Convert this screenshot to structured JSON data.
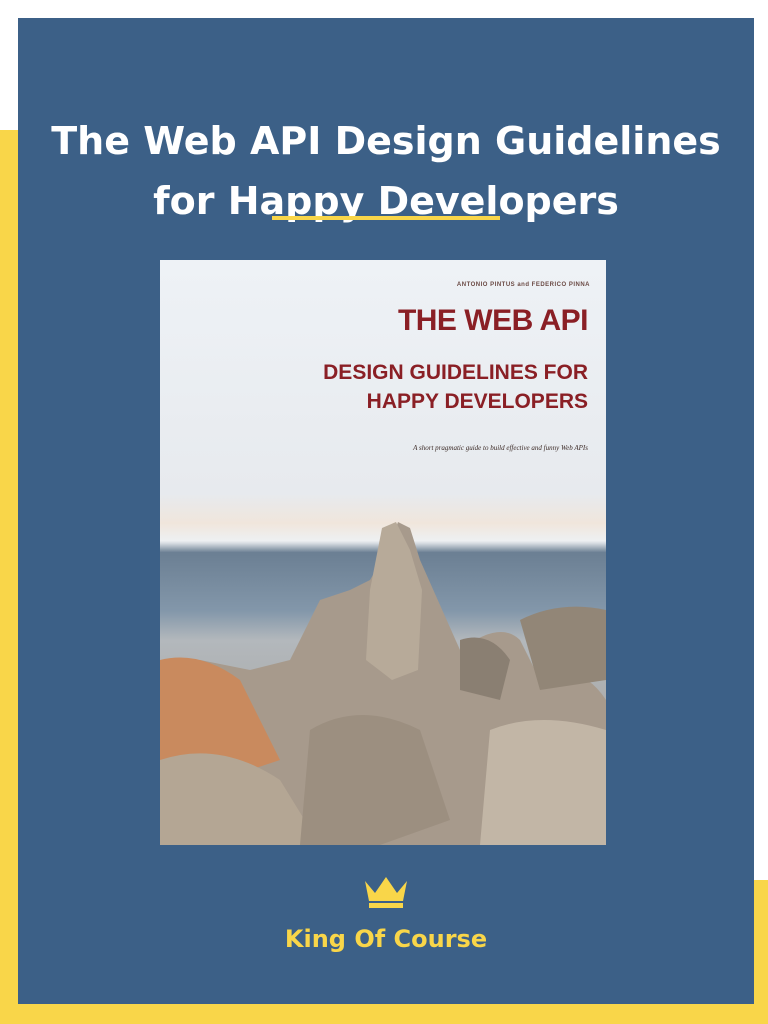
{
  "headline": {
    "line1": "The Web API Design Guidelines",
    "line2": "for Happy Developers"
  },
  "book": {
    "authors": "ANTONIO PINTUS  and  FEDERICO PINNA",
    "title": "THE WEB API",
    "subtitle_line1": "DESIGN GUIDELINES FOR",
    "subtitle_line2": "HAPPY DEVELOPERS",
    "tagline": "A short pragmatic guide to build effective and funny Web APIs"
  },
  "brand": {
    "icon": "crown-icon",
    "name": "King Of Course"
  },
  "colors": {
    "panel": "#3c6087",
    "accent": "#f9d649",
    "book_title": "#8a1f25",
    "text": "#ffffff"
  }
}
